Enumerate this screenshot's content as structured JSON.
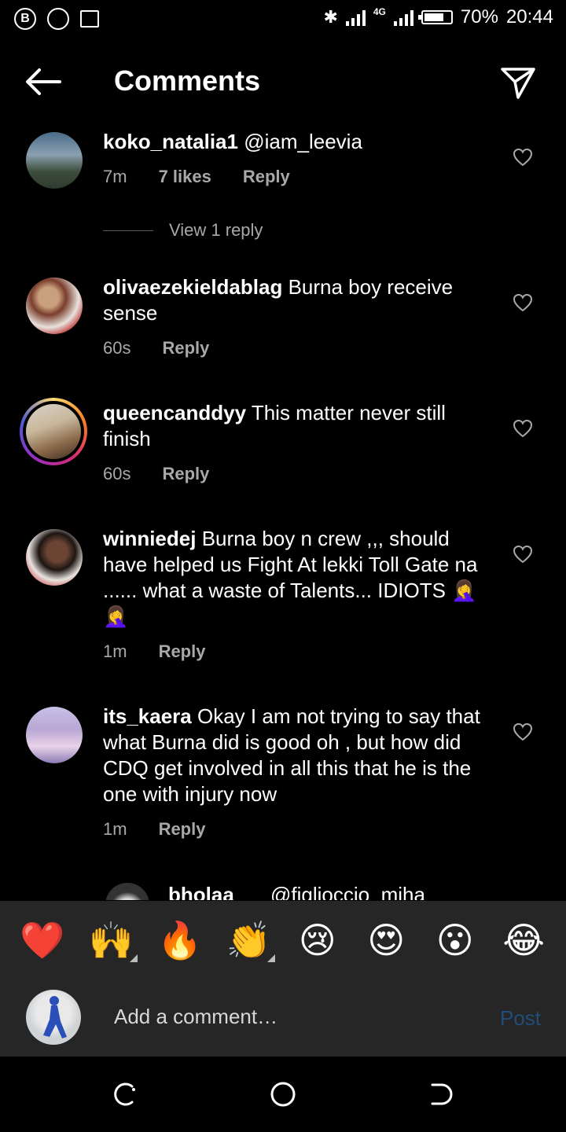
{
  "status_bar": {
    "left_icons": [
      "b-circle-icon",
      "chrome-icon",
      "cast-icon"
    ],
    "network_label": "4G",
    "battery_percent": "70%",
    "time": "20:44"
  },
  "header": {
    "title": "Comments"
  },
  "comments": [
    {
      "username": "koko_natalia1",
      "text": "@iam_leevia",
      "time": "7m",
      "likes": "7 likes",
      "reply": "Reply",
      "view_replies": "View 1 reply"
    },
    {
      "username": "olivaezekieldablag",
      "text": "Burna boy receive sense",
      "time": "60s",
      "reply": "Reply"
    },
    {
      "username": "queencanddyy",
      "text": "This matter never still finish",
      "time": "60s",
      "reply": "Reply"
    },
    {
      "username": "winniedej",
      "text": "Burna boy n crew ,,, should have helped us Fight At lekki Toll Gate na ...... what a waste of Talents... IDIOTS 🤦‍♀️🤦‍♀️",
      "time": "1m",
      "reply": "Reply"
    },
    {
      "username": "its_kaera",
      "text": "Okay I am not trying to say that what Burna did is good oh , but how did CDQ get involved in all this that he is the one with injury now",
      "time": "1m",
      "reply": "Reply"
    }
  ],
  "partial_reply": {
    "username": "bholaa",
    "text": "@figlioccio_miha"
  },
  "emoji_bar": [
    "❤️",
    "🙌",
    "🔥",
    "👏",
    "😢",
    "😍",
    "😮",
    "😂"
  ],
  "composer": {
    "placeholder": "Add a comment…",
    "post_label": "Post"
  },
  "colors": {
    "background": "#000000",
    "secondary_text": "#a8a8a8",
    "bar_background": "#262626",
    "post_disabled": "#204d7a"
  }
}
